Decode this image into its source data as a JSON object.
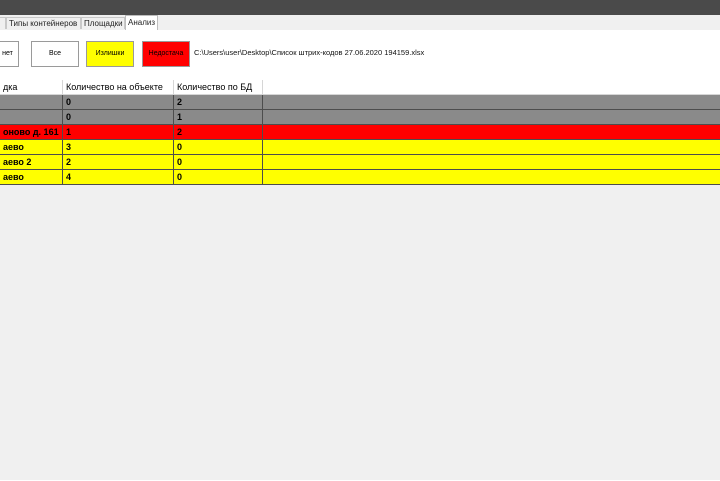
{
  "window": {
    "titlebar_color": "#4a4a4a"
  },
  "tabs": [
    {
      "label": "",
      "active": false
    },
    {
      "label": "Типы контейнеров",
      "active": false
    },
    {
      "label": "Площадки",
      "active": false
    },
    {
      "label": "Анализ",
      "active": true
    }
  ],
  "toolbar": {
    "report_label": "нет",
    "all_label": "Все",
    "surplus_label": "Излишки",
    "shortage_label": "Недостача",
    "file_path": "C:\\Users\\user\\Desktop\\Список штрих-кодов 27.06.2020 194159.xlsx"
  },
  "colors": {
    "gray": "#8a8a8a",
    "red": "#ff0000",
    "yellow": "#ffff00",
    "white": "#ffffff"
  },
  "table": {
    "columns": [
      "дка",
      "Количество на объекте",
      "Количество по БД"
    ],
    "rows": [
      {
        "site": "",
        "on_site": "0",
        "in_db": "2",
        "color": "gray"
      },
      {
        "site": "",
        "on_site": "0",
        "in_db": "1",
        "color": "gray"
      },
      {
        "site": "оново д. 161",
        "on_site": "1",
        "in_db": "2",
        "color": "red"
      },
      {
        "site": "аево",
        "on_site": "3",
        "in_db": "0",
        "color": "yellow"
      },
      {
        "site": "аево 2",
        "on_site": "2",
        "in_db": "0",
        "color": "yellow"
      },
      {
        "site": "аево",
        "on_site": "4",
        "in_db": "0",
        "color": "yellow"
      }
    ]
  }
}
